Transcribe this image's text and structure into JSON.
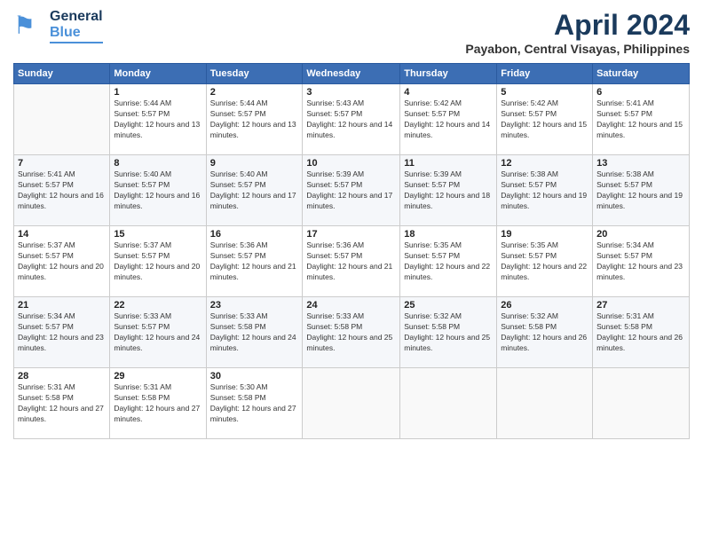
{
  "header": {
    "logo": {
      "general": "General",
      "blue": "Blue"
    },
    "title": "April 2024",
    "subtitle": "Payabon, Central Visayas, Philippines"
  },
  "weekdays": [
    "Sunday",
    "Monday",
    "Tuesday",
    "Wednesday",
    "Thursday",
    "Friday",
    "Saturday"
  ],
  "weeks": [
    [
      {
        "day": "",
        "sunrise": "",
        "sunset": "",
        "daylight": ""
      },
      {
        "day": "1",
        "sunrise": "Sunrise: 5:44 AM",
        "sunset": "Sunset: 5:57 PM",
        "daylight": "Daylight: 12 hours and 13 minutes."
      },
      {
        "day": "2",
        "sunrise": "Sunrise: 5:44 AM",
        "sunset": "Sunset: 5:57 PM",
        "daylight": "Daylight: 12 hours and 13 minutes."
      },
      {
        "day": "3",
        "sunrise": "Sunrise: 5:43 AM",
        "sunset": "Sunset: 5:57 PM",
        "daylight": "Daylight: 12 hours and 14 minutes."
      },
      {
        "day": "4",
        "sunrise": "Sunrise: 5:42 AM",
        "sunset": "Sunset: 5:57 PM",
        "daylight": "Daylight: 12 hours and 14 minutes."
      },
      {
        "day": "5",
        "sunrise": "Sunrise: 5:42 AM",
        "sunset": "Sunset: 5:57 PM",
        "daylight": "Daylight: 12 hours and 15 minutes."
      },
      {
        "day": "6",
        "sunrise": "Sunrise: 5:41 AM",
        "sunset": "Sunset: 5:57 PM",
        "daylight": "Daylight: 12 hours and 15 minutes."
      }
    ],
    [
      {
        "day": "7",
        "sunrise": "Sunrise: 5:41 AM",
        "sunset": "Sunset: 5:57 PM",
        "daylight": "Daylight: 12 hours and 16 minutes."
      },
      {
        "day": "8",
        "sunrise": "Sunrise: 5:40 AM",
        "sunset": "Sunset: 5:57 PM",
        "daylight": "Daylight: 12 hours and 16 minutes."
      },
      {
        "day": "9",
        "sunrise": "Sunrise: 5:40 AM",
        "sunset": "Sunset: 5:57 PM",
        "daylight": "Daylight: 12 hours and 17 minutes."
      },
      {
        "day": "10",
        "sunrise": "Sunrise: 5:39 AM",
        "sunset": "Sunset: 5:57 PM",
        "daylight": "Daylight: 12 hours and 17 minutes."
      },
      {
        "day": "11",
        "sunrise": "Sunrise: 5:39 AM",
        "sunset": "Sunset: 5:57 PM",
        "daylight": "Daylight: 12 hours and 18 minutes."
      },
      {
        "day": "12",
        "sunrise": "Sunrise: 5:38 AM",
        "sunset": "Sunset: 5:57 PM",
        "daylight": "Daylight: 12 hours and 19 minutes."
      },
      {
        "day": "13",
        "sunrise": "Sunrise: 5:38 AM",
        "sunset": "Sunset: 5:57 PM",
        "daylight": "Daylight: 12 hours and 19 minutes."
      }
    ],
    [
      {
        "day": "14",
        "sunrise": "Sunrise: 5:37 AM",
        "sunset": "Sunset: 5:57 PM",
        "daylight": "Daylight: 12 hours and 20 minutes."
      },
      {
        "day": "15",
        "sunrise": "Sunrise: 5:37 AM",
        "sunset": "Sunset: 5:57 PM",
        "daylight": "Daylight: 12 hours and 20 minutes."
      },
      {
        "day": "16",
        "sunrise": "Sunrise: 5:36 AM",
        "sunset": "Sunset: 5:57 PM",
        "daylight": "Daylight: 12 hours and 21 minutes."
      },
      {
        "day": "17",
        "sunrise": "Sunrise: 5:36 AM",
        "sunset": "Sunset: 5:57 PM",
        "daylight": "Daylight: 12 hours and 21 minutes."
      },
      {
        "day": "18",
        "sunrise": "Sunrise: 5:35 AM",
        "sunset": "Sunset: 5:57 PM",
        "daylight": "Daylight: 12 hours and 22 minutes."
      },
      {
        "day": "19",
        "sunrise": "Sunrise: 5:35 AM",
        "sunset": "Sunset: 5:57 PM",
        "daylight": "Daylight: 12 hours and 22 minutes."
      },
      {
        "day": "20",
        "sunrise": "Sunrise: 5:34 AM",
        "sunset": "Sunset: 5:57 PM",
        "daylight": "Daylight: 12 hours and 23 minutes."
      }
    ],
    [
      {
        "day": "21",
        "sunrise": "Sunrise: 5:34 AM",
        "sunset": "Sunset: 5:57 PM",
        "daylight": "Daylight: 12 hours and 23 minutes."
      },
      {
        "day": "22",
        "sunrise": "Sunrise: 5:33 AM",
        "sunset": "Sunset: 5:57 PM",
        "daylight": "Daylight: 12 hours and 24 minutes."
      },
      {
        "day": "23",
        "sunrise": "Sunrise: 5:33 AM",
        "sunset": "Sunset: 5:58 PM",
        "daylight": "Daylight: 12 hours and 24 minutes."
      },
      {
        "day": "24",
        "sunrise": "Sunrise: 5:33 AM",
        "sunset": "Sunset: 5:58 PM",
        "daylight": "Daylight: 12 hours and 25 minutes."
      },
      {
        "day": "25",
        "sunrise": "Sunrise: 5:32 AM",
        "sunset": "Sunset: 5:58 PM",
        "daylight": "Daylight: 12 hours and 25 minutes."
      },
      {
        "day": "26",
        "sunrise": "Sunrise: 5:32 AM",
        "sunset": "Sunset: 5:58 PM",
        "daylight": "Daylight: 12 hours and 26 minutes."
      },
      {
        "day": "27",
        "sunrise": "Sunrise: 5:31 AM",
        "sunset": "Sunset: 5:58 PM",
        "daylight": "Daylight: 12 hours and 26 minutes."
      }
    ],
    [
      {
        "day": "28",
        "sunrise": "Sunrise: 5:31 AM",
        "sunset": "Sunset: 5:58 PM",
        "daylight": "Daylight: 12 hours and 27 minutes."
      },
      {
        "day": "29",
        "sunrise": "Sunrise: 5:31 AM",
        "sunset": "Sunset: 5:58 PM",
        "daylight": "Daylight: 12 hours and 27 minutes."
      },
      {
        "day": "30",
        "sunrise": "Sunrise: 5:30 AM",
        "sunset": "Sunset: 5:58 PM",
        "daylight": "Daylight: 12 hours and 27 minutes."
      },
      {
        "day": "",
        "sunrise": "",
        "sunset": "",
        "daylight": ""
      },
      {
        "day": "",
        "sunrise": "",
        "sunset": "",
        "daylight": ""
      },
      {
        "day": "",
        "sunrise": "",
        "sunset": "",
        "daylight": ""
      },
      {
        "day": "",
        "sunrise": "",
        "sunset": "",
        "daylight": ""
      }
    ]
  ]
}
